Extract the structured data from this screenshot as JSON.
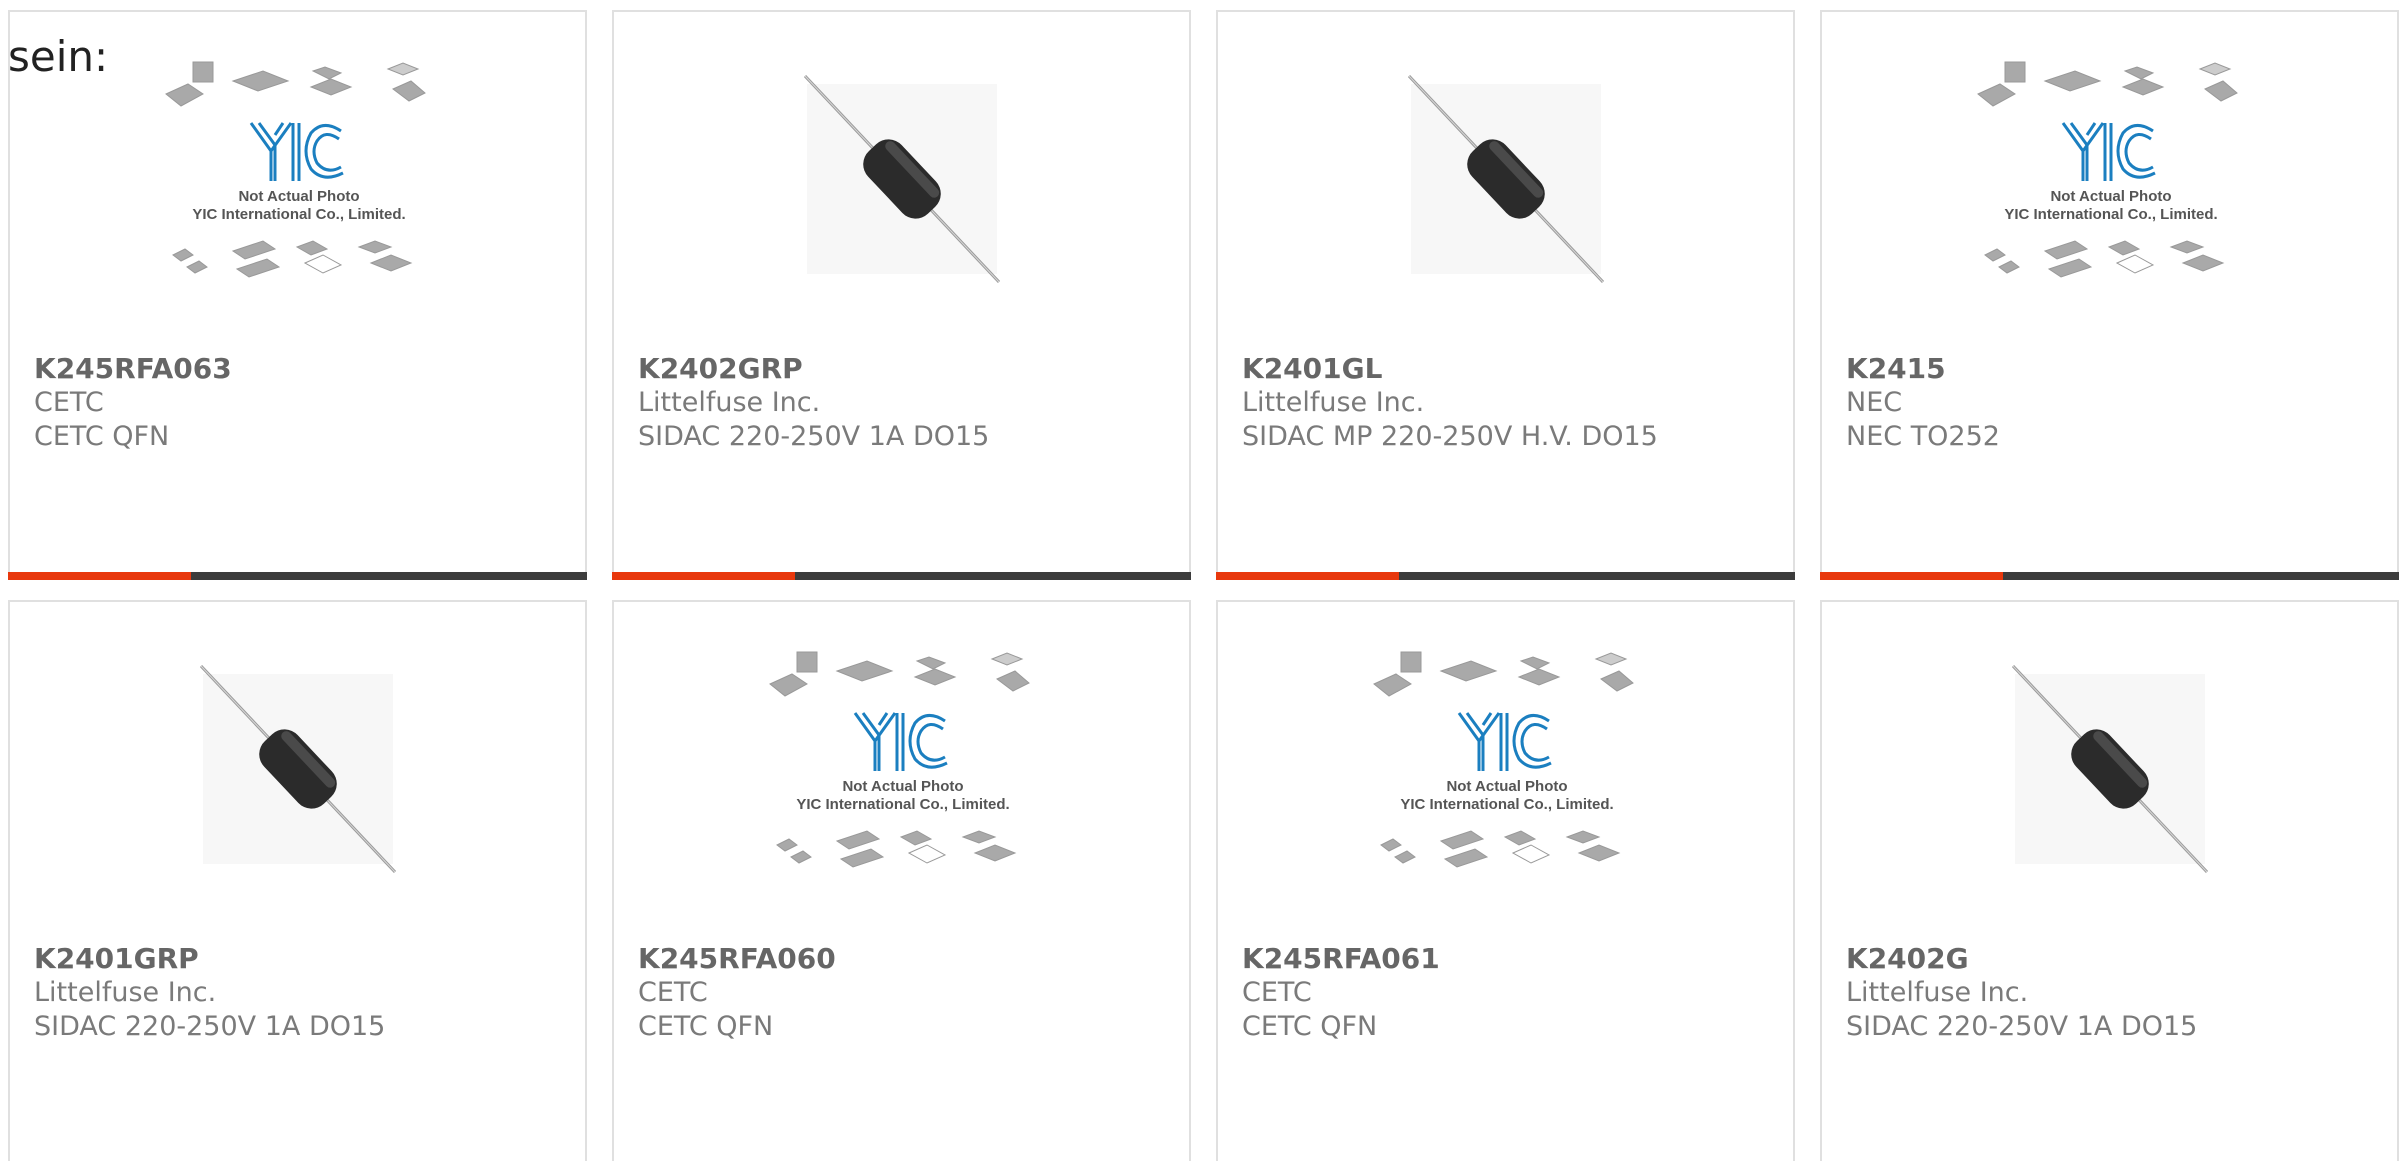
{
  "intro_text": "sein:",
  "colors": {
    "accent": "#e8380d",
    "bar": "#3c3c3c",
    "border": "#e0e0e0",
    "logo_blue": "#1b7fc0"
  },
  "placeholder": {
    "line1": "Not Actual Photo",
    "line2": "YIC International Co., Limited.",
    "logo": "YIC"
  },
  "products": [
    {
      "part": "K245RFA063",
      "maker": "CETC",
      "desc": "CETC QFN",
      "image": "yic-placeholder"
    },
    {
      "part": "K2402GRP",
      "maker": "Littelfuse Inc.",
      "desc": "SIDAC 220-250V 1A DO15",
      "image": "axial-diode"
    },
    {
      "part": "K2401GL",
      "maker": "Littelfuse Inc.",
      "desc": "SIDAC MP 220-250V H.V. DO15",
      "image": "axial-diode"
    },
    {
      "part": "K2415",
      "maker": "NEC",
      "desc": "NEC TO252",
      "image": "yic-placeholder"
    },
    {
      "part": "K2401GRP",
      "maker": "Littelfuse Inc.",
      "desc": "SIDAC 220-250V 1A DO15",
      "image": "axial-diode"
    },
    {
      "part": "K245RFA060",
      "maker": "CETC",
      "desc": "CETC QFN",
      "image": "yic-placeholder"
    },
    {
      "part": "K245RFA061",
      "maker": "CETC",
      "desc": "CETC QFN",
      "image": "yic-placeholder"
    },
    {
      "part": "K2402G",
      "maker": "Littelfuse Inc.",
      "desc": "SIDAC 220-250V 1A DO15",
      "image": "axial-diode"
    }
  ]
}
